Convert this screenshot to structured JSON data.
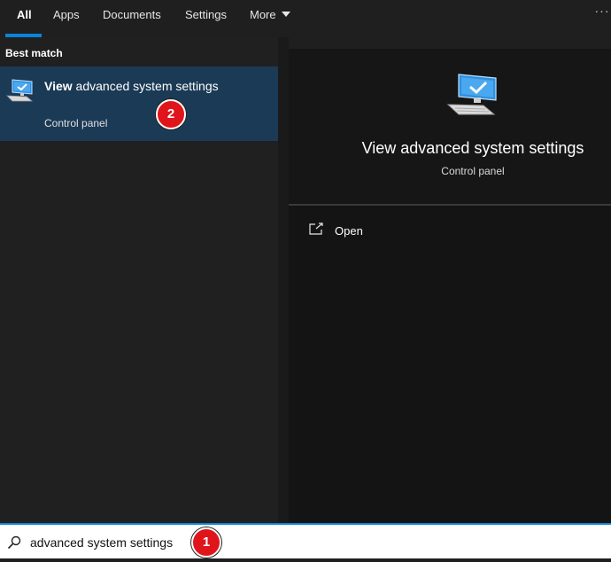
{
  "tabs": [
    {
      "label": "All",
      "active": true
    },
    {
      "label": "Apps"
    },
    {
      "label": "Documents"
    },
    {
      "label": "Settings"
    },
    {
      "label": "More"
    }
  ],
  "options_glyph": "···",
  "results": {
    "section_label": "Best match",
    "best": {
      "title_bold": "View",
      "title_rest": " advanced system settings",
      "subtitle": "Control panel",
      "icon": "computer-check-icon"
    }
  },
  "preview": {
    "title": "View advanced system settings",
    "subtitle": "Control panel",
    "icon": "computer-check-icon",
    "actions": [
      {
        "label": "Open",
        "icon": "open-external-icon"
      }
    ]
  },
  "search": {
    "value": "advanced system settings",
    "icon": "search-icon"
  },
  "callouts": [
    "2",
    "1"
  ],
  "colors": {
    "accent": "#0a84d8",
    "selection": "#1b3a56",
    "callout": "#e0151b"
  }
}
